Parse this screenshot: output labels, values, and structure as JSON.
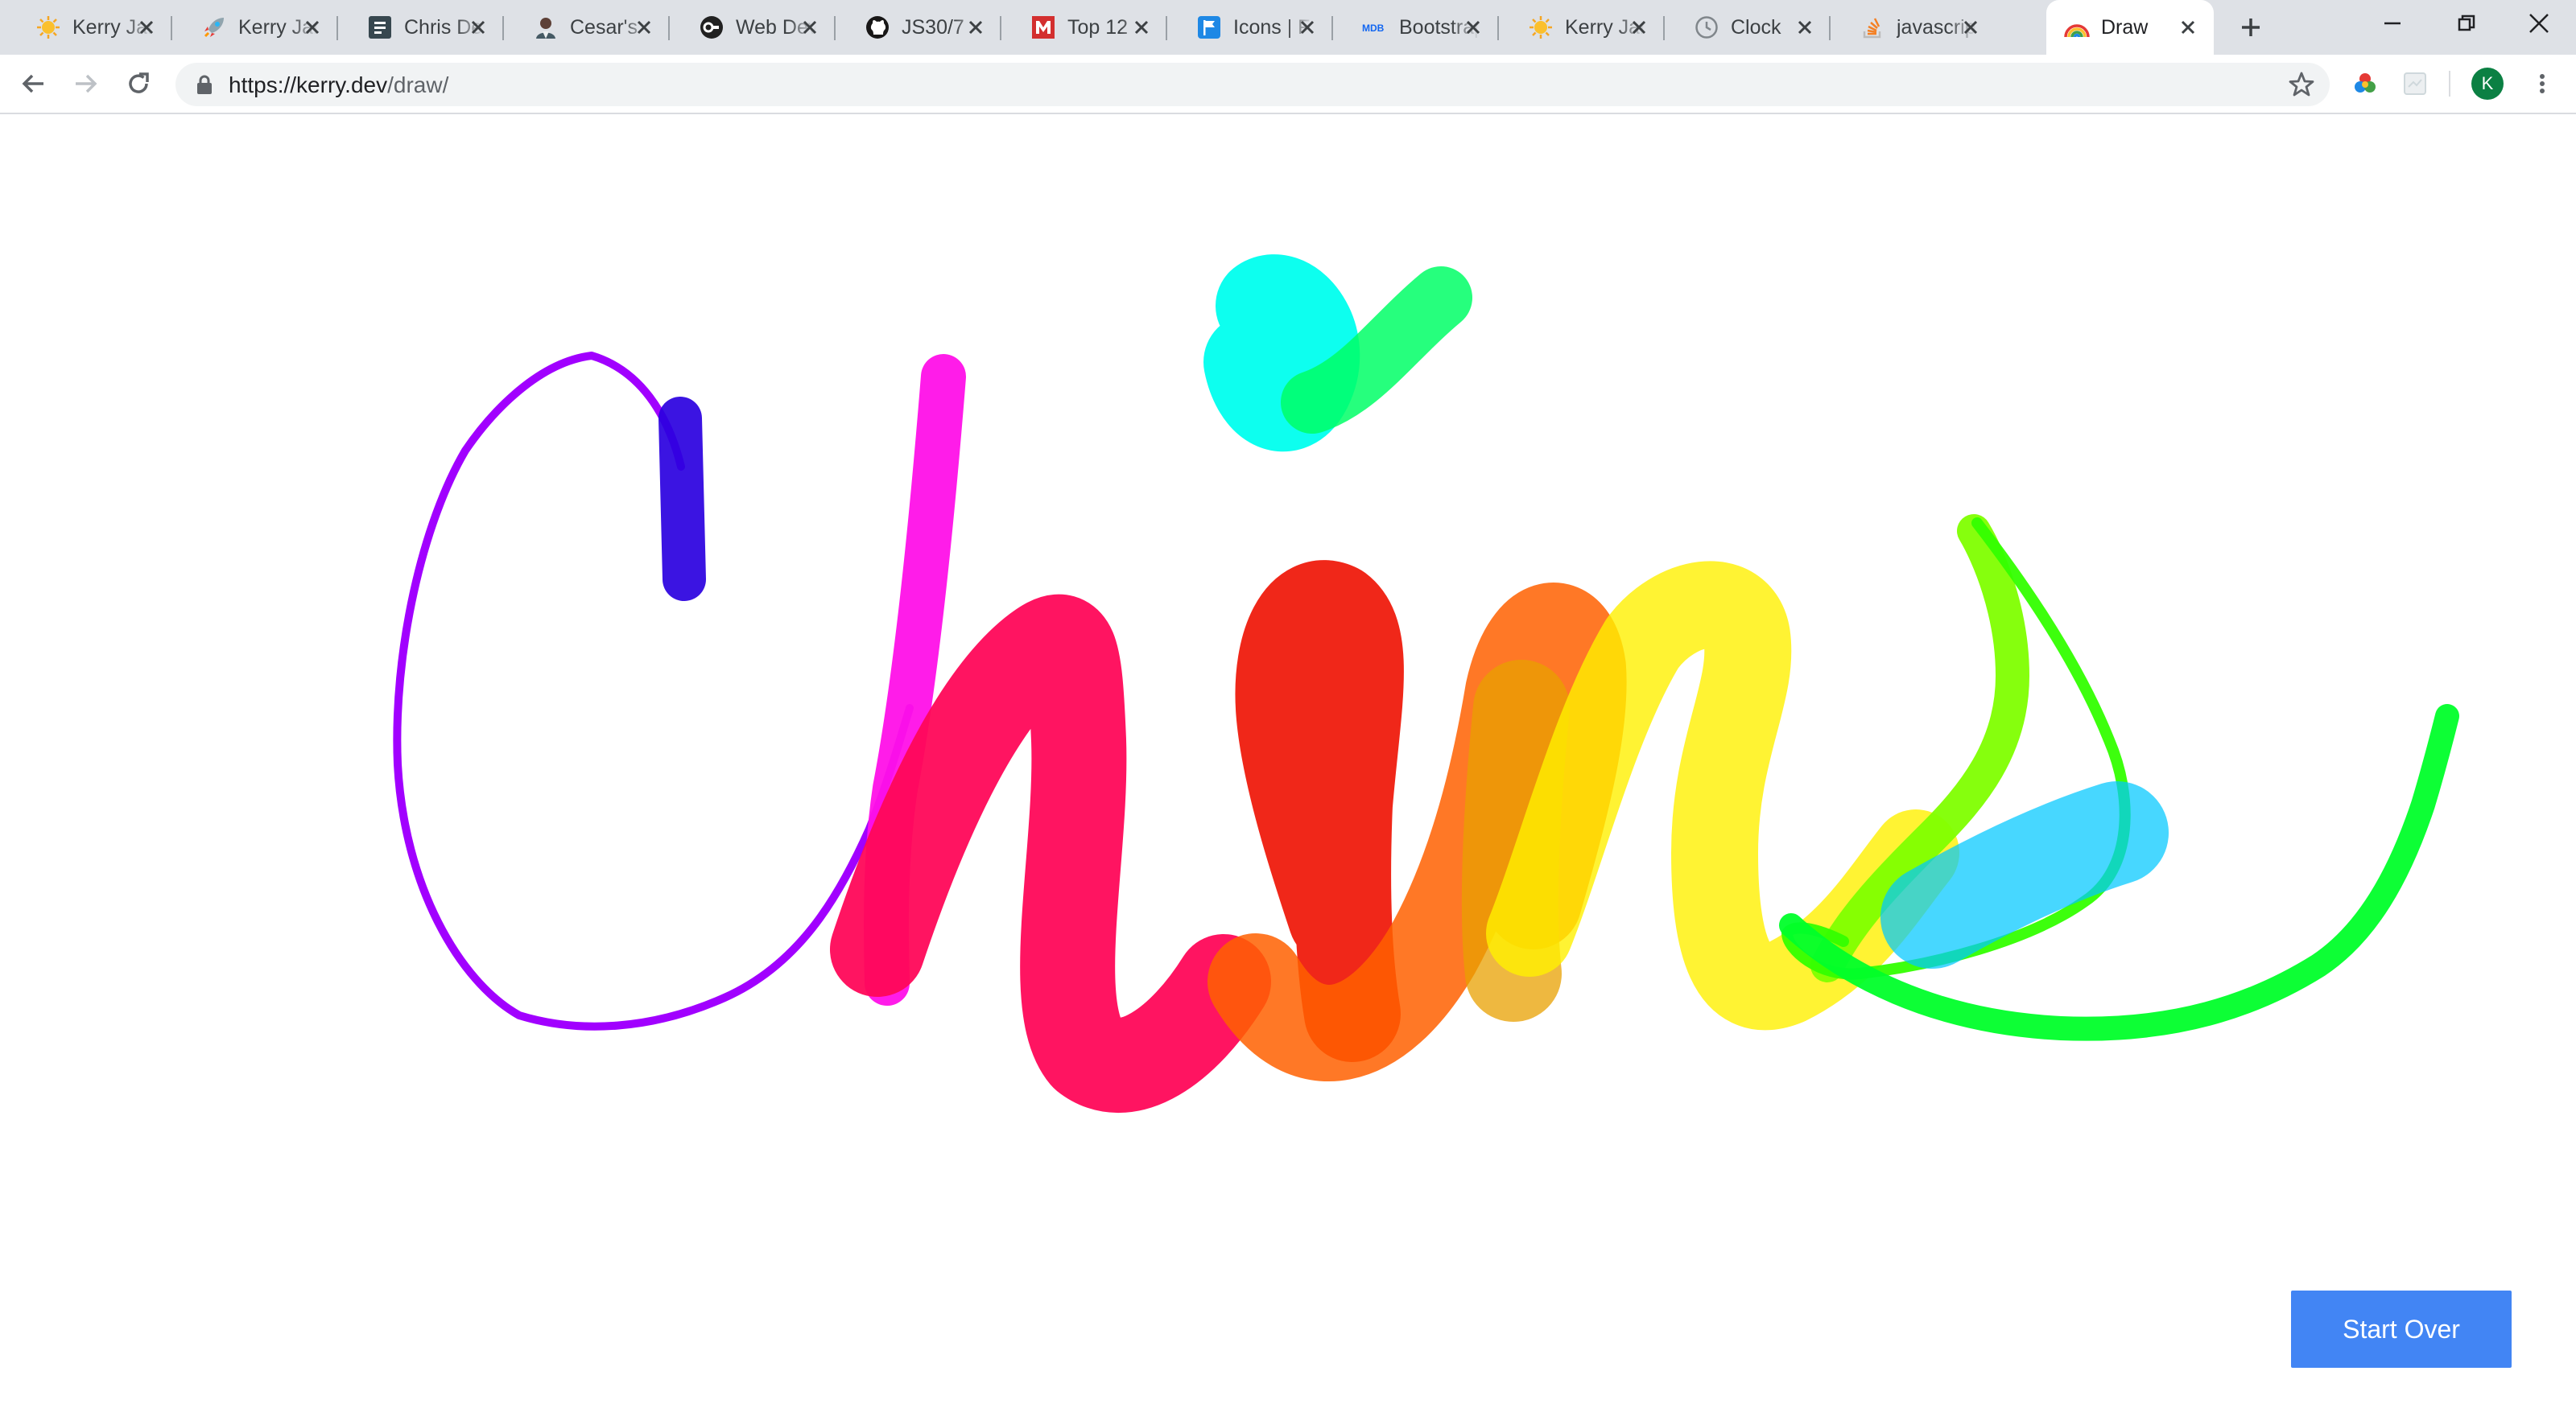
{
  "browser": {
    "tabs": [
      {
        "title": "Kerry James",
        "favicon": "sun-emoji-icon"
      },
      {
        "title": "Kerry James",
        "favicon": "rocket-emoji-icon"
      },
      {
        "title": "Chris Dev",
        "favicon": "document-icon"
      },
      {
        "title": "Cesar's",
        "favicon": "person-photo-icon"
      },
      {
        "title": "Web Dev",
        "favicon": "web-dev-logo-icon"
      },
      {
        "title": "JS30/7",
        "favicon": "github-icon"
      },
      {
        "title": "Top 12",
        "favicon": "m-logo-icon"
      },
      {
        "title": "Icons | F",
        "favicon": "flag-icon"
      },
      {
        "title": "Bootstrap",
        "favicon": "mdb-logo-icon"
      },
      {
        "title": "Kerry James",
        "favicon": "sun-emoji-icon"
      },
      {
        "title": "Clock",
        "favicon": "clock-icon"
      },
      {
        "title": "javascript",
        "favicon": "stack-icon"
      },
      {
        "title": "Draw",
        "favicon": "rainbow-icon",
        "active": true
      }
    ],
    "address": {
      "host": "https://kerry.dev",
      "path": "/draw/"
    },
    "profile_initial": "K"
  },
  "page": {
    "start_over_label": "Start Over"
  },
  "colors": {
    "tabstrip": "#dee1e6",
    "button": "#4285f4",
    "avatar": "#0b8043"
  }
}
